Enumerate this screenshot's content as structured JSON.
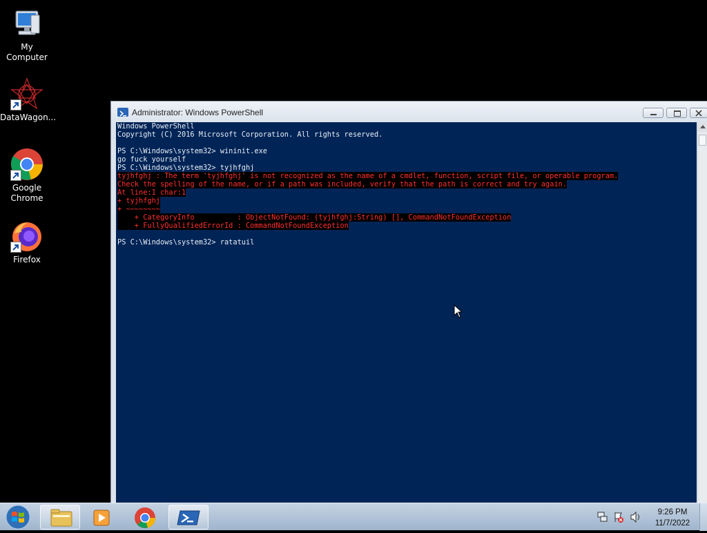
{
  "desktop": {
    "icons": [
      {
        "label": "My Computer"
      },
      {
        "label": "DataWagon..."
      },
      {
        "label": "Google\nChrome"
      },
      {
        "label": "Firefox"
      }
    ]
  },
  "window": {
    "title": "Administrator: Windows PowerShell",
    "console_lines": [
      {
        "text": "Windows PowerShell",
        "error": false
      },
      {
        "text": "Copyright (C) 2016 Microsoft Corporation. All rights reserved.",
        "error": false
      },
      {
        "text": "",
        "error": false
      },
      {
        "text": "PS C:\\Windows\\system32> wininit.exe",
        "error": false
      },
      {
        "text": "go fuck yourself",
        "error": false
      },
      {
        "text": "PS C:\\Windows\\system32> tyjhfghj",
        "error": false
      },
      {
        "text": "tyjhfghj : The term 'tyjhfghj' is not recognized as the name of a cmdlet, function, script file, or operable program.",
        "error": true
      },
      {
        "text": "Check the spelling of the name, or if a path was included, verify that the path is correct and try again.",
        "error": true
      },
      {
        "text": "At line:1 char:1",
        "error": true
      },
      {
        "text": "+ tyjhfghj",
        "error": true
      },
      {
        "text": "+ ~~~~~~~~",
        "error": true
      },
      {
        "text": "    + CategoryInfo          : ObjectNotFound: (tyjhfghj:String) [], CommandNotFoundException",
        "error": true
      },
      {
        "text": "    + FullyQualifiedErrorId : CommandNotFoundException",
        "error": true
      },
      {
        "text": "",
        "error": false
      },
      {
        "text": "PS C:\\Windows\\system32> ratatuil",
        "error": false
      }
    ]
  },
  "taskbar": {
    "clock_time": "9:26 PM",
    "clock_date": "11/7/2022",
    "pinned": [
      "windows-explorer",
      "media-player",
      "google-chrome",
      "windows-powershell"
    ],
    "active": "windows-powershell"
  },
  "colors": {
    "console_bg": "#012456",
    "console_fg": "#e8eef6",
    "error_fg": "#ff2f2f",
    "error_bg": "#000000"
  }
}
